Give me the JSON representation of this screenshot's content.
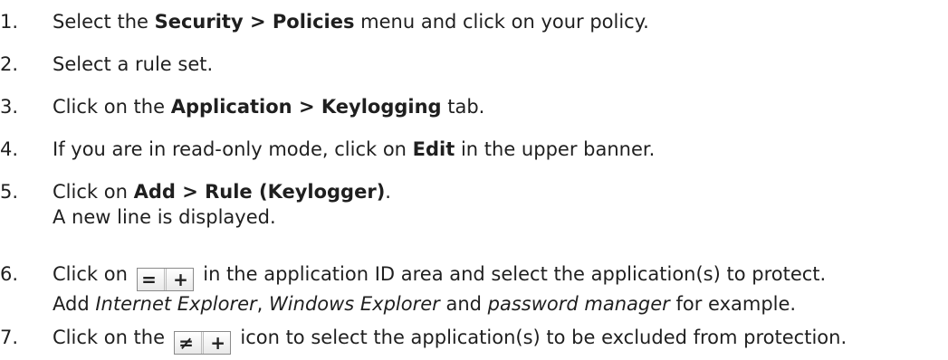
{
  "steps": [
    {
      "number": "1.",
      "t1": "Select the ",
      "b1": "Security > Policies",
      "t2": " menu and click on your policy."
    },
    {
      "number": "2.",
      "t1": "Select a rule set."
    },
    {
      "number": "3.",
      "t1": "Click on the ",
      "b1": "Application > Keylogging",
      "t2": " tab."
    },
    {
      "number": "4.",
      "t1": "If you are in read-only mode, click on ",
      "b1": "Edit",
      "t2": " in the upper banner."
    },
    {
      "number": "5.",
      "t1": "Click on ",
      "b1": "Add > Rule (Keylogger)",
      "t2": ".",
      "line2": "A new line is displayed."
    },
    {
      "number": "6.",
      "t1": "Click on ",
      "icon_eq": "=",
      "icon_plus": "+",
      "t2": " in the application ID area and select the application(s) to protect.",
      "l2a": "Add ",
      "l2i1": "Internet Explorer",
      "l2b": ", ",
      "l2i2": "Windows Explorer",
      "l2c": " and ",
      "l2i3": "password manager",
      "l2d": " for example."
    },
    {
      "number": "7.",
      "t1": "Click on the ",
      "icon_neq": "≠",
      "icon_plus": "+",
      "t2": " icon to select the application(s) to be excluded from protection."
    }
  ]
}
